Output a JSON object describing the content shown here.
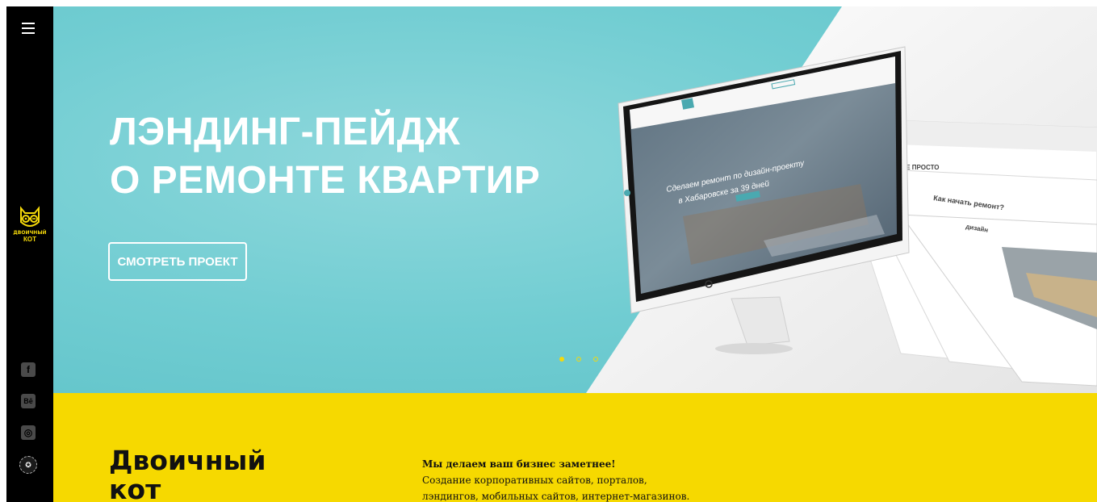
{
  "sidebar": {
    "menu_icon": "hamburger-icon",
    "logo": {
      "icon": "cat-glasses-icon",
      "line1": "ДВОИЧНЫЙ",
      "line2": "КОТ"
    },
    "social": [
      {
        "icon": "facebook-icon",
        "glyph": "f"
      },
      {
        "icon": "behance-icon",
        "glyph": "Bē"
      },
      {
        "icon": "instagram-icon",
        "glyph": "◎"
      }
    ],
    "badge_icon": "round-badge-icon"
  },
  "hero": {
    "title_line1": "ЛЭНДИНГ-ПЕЙДЖ",
    "title_line2": "О РЕМОНТЕ КВАРТИР",
    "button_label": "СМОТРЕТЬ ПРОЕКТ",
    "slides": {
      "total": 3,
      "active": 1
    },
    "mockup": {
      "screen_headline_1": "Сделаем ремонт по дизайн-проекту",
      "screen_headline_2": "в Хабаровске за 39 дней",
      "page2_heading": "ВСЕ ПРОСТО",
      "page3_heading": "Как начать ремонт?",
      "page4_heading": "дизайн"
    }
  },
  "about": {
    "brand_line1": "Двоичный",
    "brand_line2": "кот",
    "tagline": "Мы делаем ваш бизнес заметнее!",
    "text_line1": "Создание корпоративных сайтов, порталов,",
    "text_line2": "лэндингов, мобильных сайтов, интернет-магазинов."
  },
  "colors": {
    "accent": "#f6d900",
    "hero_bg": "#71cdd2",
    "sidebar": "#000000"
  }
}
